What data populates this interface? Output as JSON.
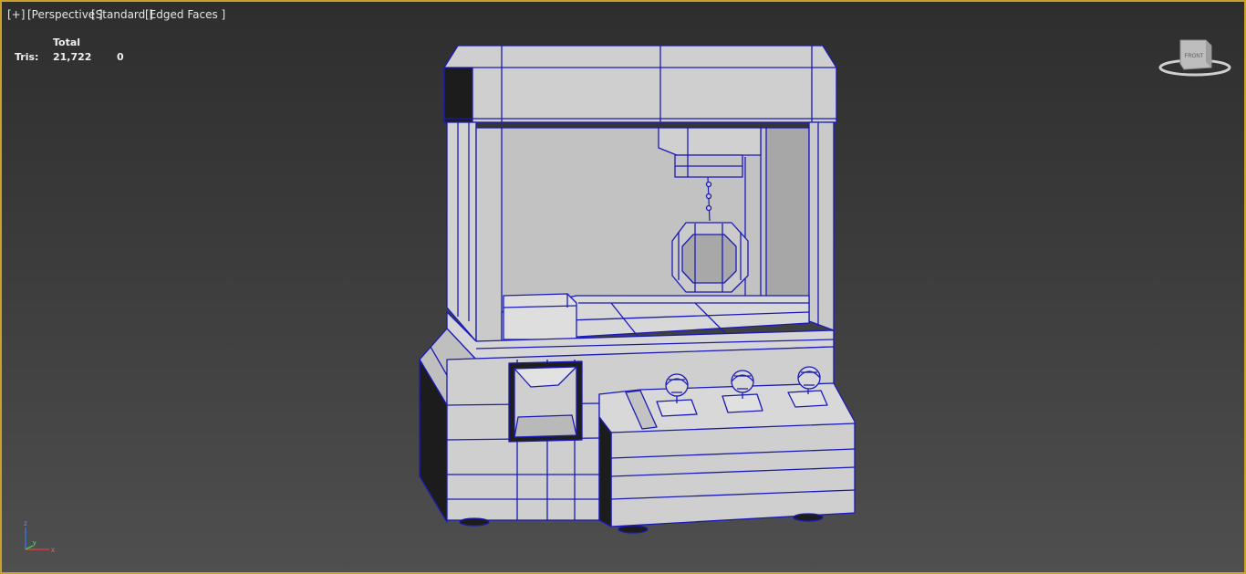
{
  "viewport": {
    "labels": {
      "plus": "[+]",
      "perspective": "[Perspective ]",
      "standard": "[Standard ]",
      "edged_faces": "[Edged Faces ]"
    },
    "stats": {
      "header": "Total",
      "tris_label": "Tris:",
      "tris_total": "21,722",
      "tris_selected": "0"
    },
    "viewcube": {
      "face_label": "FRONT"
    },
    "axis_tripod": {
      "x": "x",
      "y": "y",
      "z": "z"
    },
    "colors": {
      "frame_border": "#c9a227",
      "wireframe": "#1a1ab8",
      "surface_light": "#d4d4d4",
      "surface_mid": "#bdbdbd",
      "surface_dark": "#1e1e1e"
    },
    "object": "claw machine (edged faces wireframe)"
  }
}
